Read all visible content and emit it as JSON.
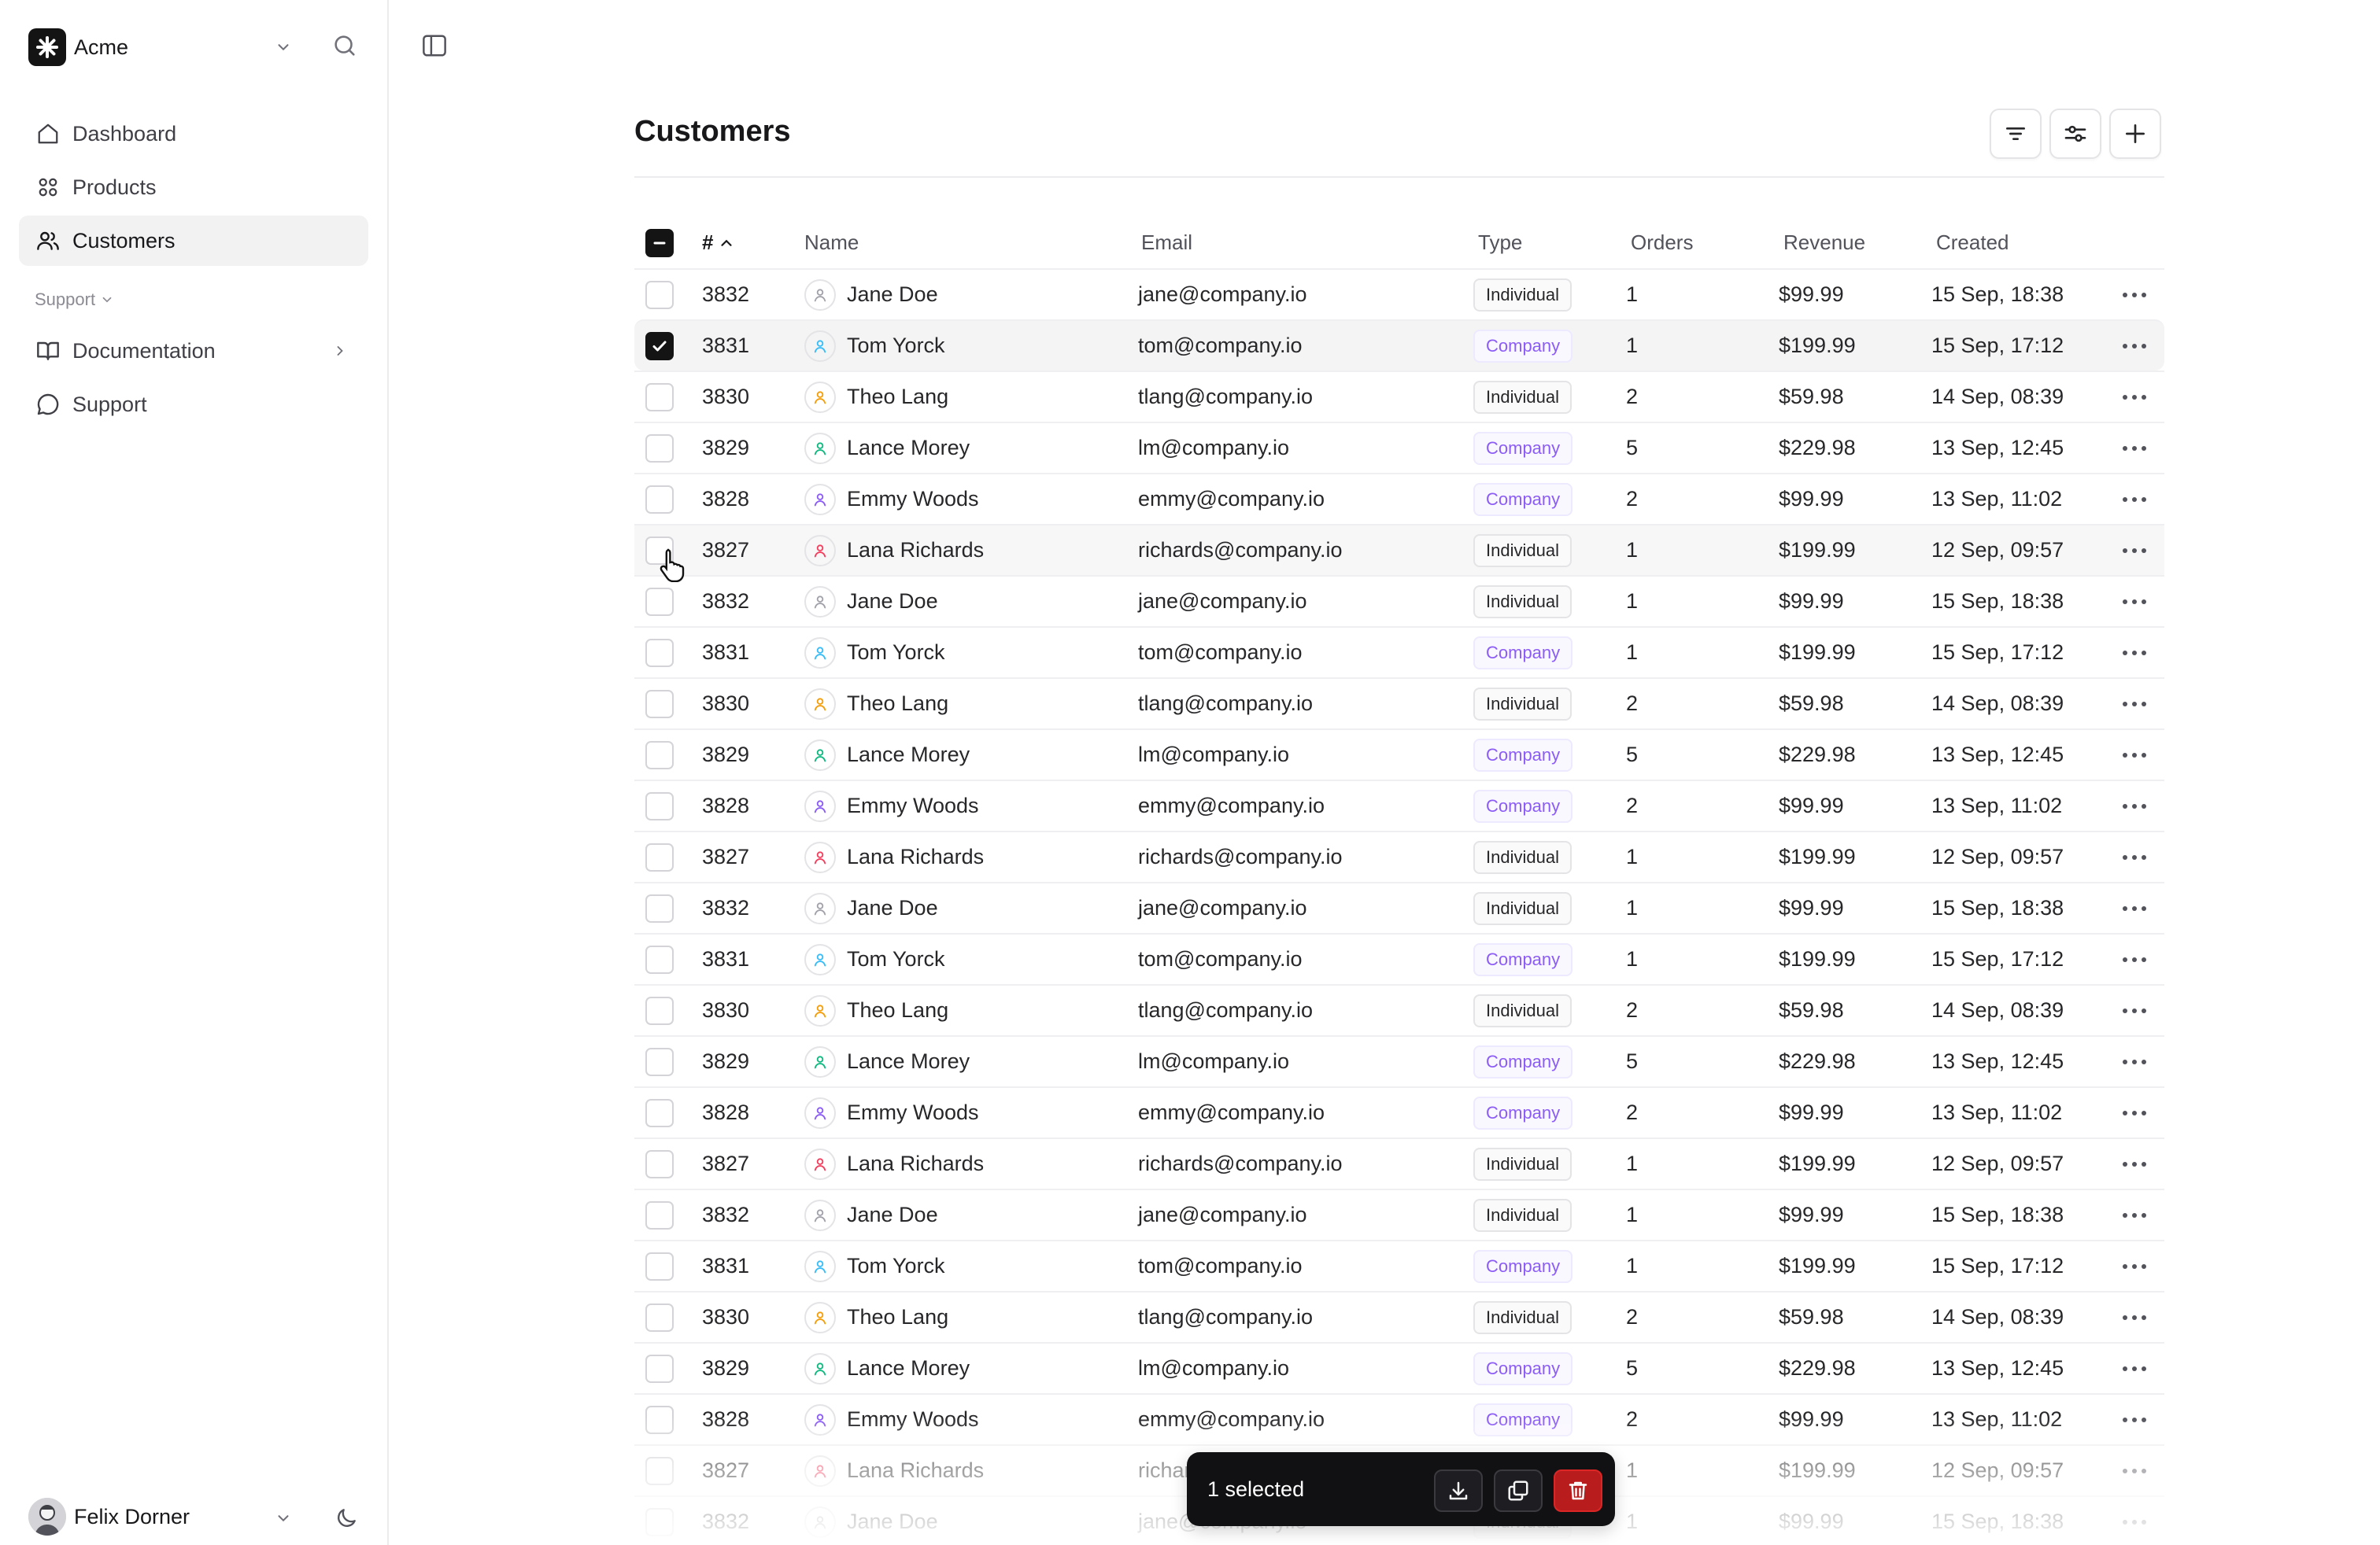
{
  "app": {
    "name": "Acme"
  },
  "sidebar": {
    "items": [
      {
        "label": "Dashboard",
        "icon": "home-icon"
      },
      {
        "label": "Products",
        "icon": "grid-icon"
      },
      {
        "label": "Customers",
        "icon": "users-icon",
        "active": true
      }
    ],
    "section": {
      "label": "Support"
    },
    "support_items": [
      {
        "label": "Documentation",
        "icon": "book-icon"
      },
      {
        "label": "Support",
        "icon": "chat-icon"
      }
    ],
    "user": {
      "name": "Felix Dorner"
    }
  },
  "page": {
    "title": "Customers"
  },
  "table": {
    "headers": {
      "num": "#",
      "name": "Name",
      "email": "Email",
      "type": "Type",
      "orders": "Orders",
      "revenue": "Revenue",
      "created": "Created"
    },
    "rows": [
      {
        "id": "3832",
        "name": "Jane Doe",
        "email": "jane@company.io",
        "type": "Individual",
        "orders": "1",
        "revenue": "$99.99",
        "created": "15 Sep, 18:38",
        "color": "#a1a1aa",
        "checked": false
      },
      {
        "id": "3831",
        "name": "Tom Yorck",
        "email": "tom@company.io",
        "type": "Company",
        "orders": "1",
        "revenue": "$199.99",
        "created": "15 Sep, 17:12",
        "color": "#38bdf8",
        "checked": true
      },
      {
        "id": "3830",
        "name": "Theo Lang",
        "email": "tlang@company.io",
        "type": "Individual",
        "orders": "2",
        "revenue": "$59.98",
        "created": "14 Sep, 08:39",
        "color": "#f59e0b",
        "checked": false
      },
      {
        "id": "3829",
        "name": "Lance Morey",
        "email": "lm@company.io",
        "type": "Company",
        "orders": "5",
        "revenue": "$229.98",
        "created": "13 Sep, 12:45",
        "color": "#10b981",
        "checked": false
      },
      {
        "id": "3828",
        "name": "Emmy Woods",
        "email": "emmy@company.io",
        "type": "Company",
        "orders": "2",
        "revenue": "$99.99",
        "created": "13 Sep, 11:02",
        "color": "#8b5cf6",
        "checked": false
      },
      {
        "id": "3827",
        "name": "Lana Richards",
        "email": "richards@company.io",
        "type": "Individual",
        "orders": "1",
        "revenue": "$199.99",
        "created": "12 Sep, 09:57",
        "color": "#f43f5e",
        "checked": false
      },
      {
        "id": "3832",
        "name": "Jane Doe",
        "email": "jane@company.io",
        "type": "Individual",
        "orders": "1",
        "revenue": "$99.99",
        "created": "15 Sep, 18:38",
        "color": "#a1a1aa",
        "checked": false
      },
      {
        "id": "3831",
        "name": "Tom Yorck",
        "email": "tom@company.io",
        "type": "Company",
        "orders": "1",
        "revenue": "$199.99",
        "created": "15 Sep, 17:12",
        "color": "#38bdf8",
        "checked": false
      },
      {
        "id": "3830",
        "name": "Theo Lang",
        "email": "tlang@company.io",
        "type": "Individual",
        "orders": "2",
        "revenue": "$59.98",
        "created": "14 Sep, 08:39",
        "color": "#f59e0b",
        "checked": false
      },
      {
        "id": "3829",
        "name": "Lance Morey",
        "email": "lm@company.io",
        "type": "Company",
        "orders": "5",
        "revenue": "$229.98",
        "created": "13 Sep, 12:45",
        "color": "#10b981",
        "checked": false
      },
      {
        "id": "3828",
        "name": "Emmy Woods",
        "email": "emmy@company.io",
        "type": "Company",
        "orders": "2",
        "revenue": "$99.99",
        "created": "13 Sep, 11:02",
        "color": "#8b5cf6",
        "checked": false
      },
      {
        "id": "3827",
        "name": "Lana Richards",
        "email": "richards@company.io",
        "type": "Individual",
        "orders": "1",
        "revenue": "$199.99",
        "created": "12 Sep, 09:57",
        "color": "#f43f5e",
        "checked": false
      },
      {
        "id": "3832",
        "name": "Jane Doe",
        "email": "jane@company.io",
        "type": "Individual",
        "orders": "1",
        "revenue": "$99.99",
        "created": "15 Sep, 18:38",
        "color": "#a1a1aa",
        "checked": false
      },
      {
        "id": "3831",
        "name": "Tom Yorck",
        "email": "tom@company.io",
        "type": "Company",
        "orders": "1",
        "revenue": "$199.99",
        "created": "15 Sep, 17:12",
        "color": "#38bdf8",
        "checked": false
      },
      {
        "id": "3830",
        "name": "Theo Lang",
        "email": "tlang@company.io",
        "type": "Individual",
        "orders": "2",
        "revenue": "$59.98",
        "created": "14 Sep, 08:39",
        "color": "#f59e0b",
        "checked": false
      },
      {
        "id": "3829",
        "name": "Lance Morey",
        "email": "lm@company.io",
        "type": "Company",
        "orders": "5",
        "revenue": "$229.98",
        "created": "13 Sep, 12:45",
        "color": "#10b981",
        "checked": false
      },
      {
        "id": "3828",
        "name": "Emmy Woods",
        "email": "emmy@company.io",
        "type": "Company",
        "orders": "2",
        "revenue": "$99.99",
        "created": "13 Sep, 11:02",
        "color": "#8b5cf6",
        "checked": false
      },
      {
        "id": "3827",
        "name": "Lana Richards",
        "email": "richards@company.io",
        "type": "Individual",
        "orders": "1",
        "revenue": "$199.99",
        "created": "12 Sep, 09:57",
        "color": "#f43f5e",
        "checked": false
      },
      {
        "id": "3832",
        "name": "Jane Doe",
        "email": "jane@company.io",
        "type": "Individual",
        "orders": "1",
        "revenue": "$99.99",
        "created": "15 Sep, 18:38",
        "color": "#a1a1aa",
        "checked": false
      },
      {
        "id": "3831",
        "name": "Tom Yorck",
        "email": "tom@company.io",
        "type": "Company",
        "orders": "1",
        "revenue": "$199.99",
        "created": "15 Sep, 17:12",
        "color": "#38bdf8",
        "checked": false
      },
      {
        "id": "3830",
        "name": "Theo Lang",
        "email": "tlang@company.io",
        "type": "Individual",
        "orders": "2",
        "revenue": "$59.98",
        "created": "14 Sep, 08:39",
        "color": "#f59e0b",
        "checked": false
      },
      {
        "id": "3829",
        "name": "Lance Morey",
        "email": "lm@company.io",
        "type": "Company",
        "orders": "5",
        "revenue": "$229.98",
        "created": "13 Sep, 12:45",
        "color": "#10b981",
        "checked": false
      },
      {
        "id": "3828",
        "name": "Emmy Woods",
        "email": "emmy@company.io",
        "type": "Company",
        "orders": "2",
        "revenue": "$99.99",
        "created": "13 Sep, 11:02",
        "color": "#8b5cf6",
        "checked": false
      },
      {
        "id": "3827",
        "name": "Lana Richards",
        "email": "richards@company.io",
        "type": "Individual",
        "orders": "1",
        "revenue": "$199.99",
        "created": "12 Sep, 09:57",
        "color": "#f43f5e",
        "checked": false
      },
      {
        "id": "3832",
        "name": "Jane Doe",
        "email": "jane@company.io",
        "type": "Individual",
        "orders": "1",
        "revenue": "$99.99",
        "created": "15 Sep, 18:38",
        "color": "#a1a1aa",
        "checked": false
      }
    ]
  },
  "selection_bar": {
    "label": "1 selected"
  },
  "colors": {
    "accent": "#141414",
    "company_badge": "#8b5cf6",
    "danger": "#b91c1c"
  }
}
